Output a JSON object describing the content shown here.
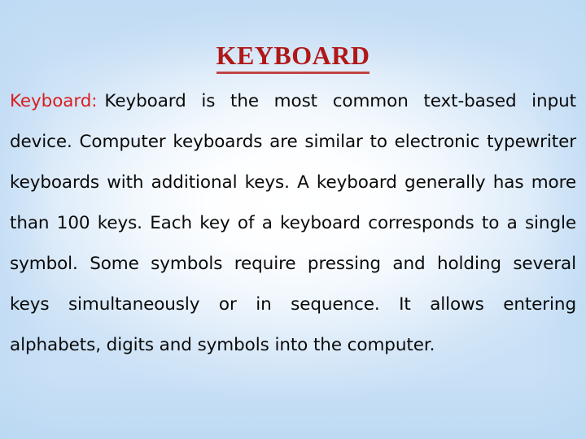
{
  "slide": {
    "title": "KEYBOARD",
    "title_color": "#b01818",
    "title_underline_color": "#c24444",
    "background": {
      "center_color": "#ffffff",
      "edge_color": "#c9e0f6",
      "type": "radial-gradient"
    },
    "body": {
      "lead_label": "Keyboard:",
      "lead_color": "#d81f1f",
      "text_color": "#0a0a0a",
      "text": "Keyboard is the most common text-based input device. Computer keyboards are similar to electronic typewriter keyboards with additional keys. A keyboard generally has more than 100 keys. Each key of a keyboard corresponds to a single symbol. Some symbols require pressing and holding several keys simultaneously or in sequence. It allows entering alphabets, digits and symbols into the computer.",
      "lines": [
        "Keyboard:  Keyboard is the most common text-based",
        "input device. Computer keyboards are similar to",
        "electronic typewriter keyboards with additional keys.",
        "A keyboard generally has more than 100 keys. Each",
        "key of a keyboard corresponds to a single symbol.",
        "Some symbols require pressing and holding several",
        "keys simultaneously or in sequence. It allows entering",
        "alphabets, digits and symbols into the computer."
      ]
    }
  }
}
